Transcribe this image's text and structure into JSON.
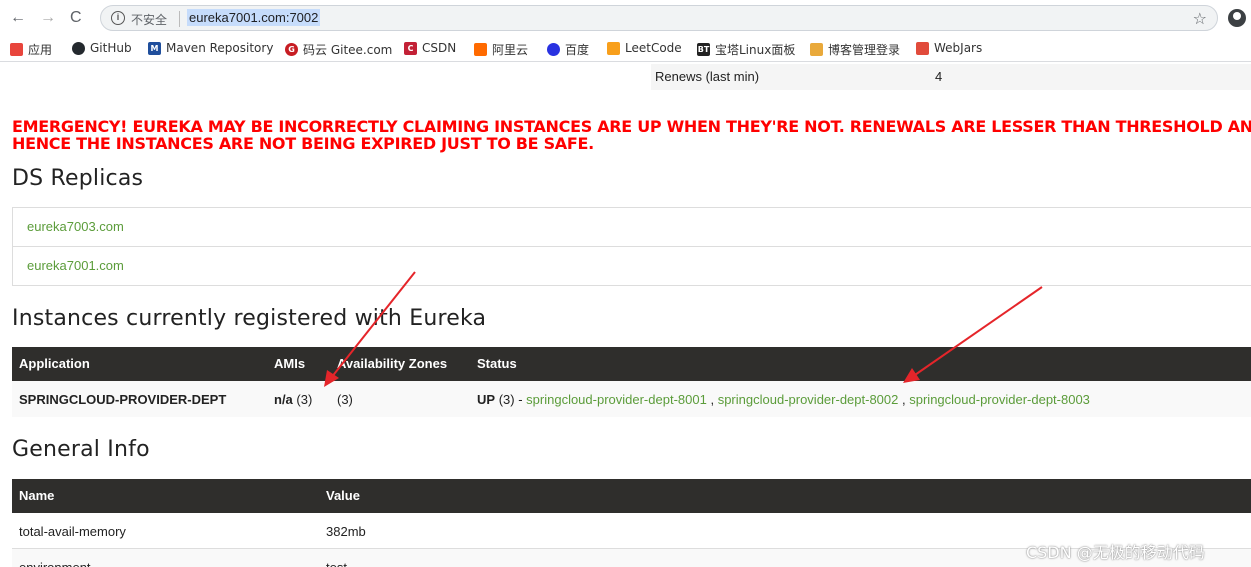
{
  "browser": {
    "insecure_label": "不安全",
    "url": "eureka7001.com:7002",
    "bookmarks": [
      {
        "label": "应用",
        "color": "#e8453c"
      },
      {
        "label": "GitHub",
        "color": "#24292e"
      },
      {
        "label": "Maven Repository",
        "color": "#1f4e9c"
      },
      {
        "label": "码云 Gitee.com",
        "color": "#c71d23"
      },
      {
        "label": "CSDN",
        "color": "#c32136"
      },
      {
        "label": "阿里云",
        "color": "#ff6a00"
      },
      {
        "label": "百度",
        "color": "#2932e1"
      },
      {
        "label": "LeetCode",
        "color": "#f89f1b"
      },
      {
        "label": "宝塔Linux面板",
        "color": "#222222"
      },
      {
        "label": "博客管理登录",
        "color": "#e9a93b"
      },
      {
        "label": "WebJars",
        "color": "#e14b3b"
      }
    ]
  },
  "renews": {
    "label": "Renews (last min)",
    "value": "4"
  },
  "emergency": {
    "line1": "EMERGENCY! EUREKA MAY BE INCORRECTLY CLAIMING INSTANCES ARE UP WHEN THEY'RE NOT. RENEWALS ARE LESSER THAN THRESHOLD AND",
    "line2": "HENCE THE INSTANCES ARE NOT BEING EXPIRED JUST TO BE SAFE."
  },
  "replicas": {
    "title": "DS Replicas",
    "items": [
      "eureka7003.com",
      "eureka7001.com"
    ]
  },
  "instances": {
    "title": "Instances currently registered with Eureka",
    "headers": [
      "Application",
      "AMIs",
      "Availability Zones",
      "Status"
    ],
    "row": {
      "application": "SPRINGCLOUD-PROVIDER-DEPT",
      "amis_bold": "n/a",
      "amis_count": "(3)",
      "zones": "(3)",
      "status_bold": "UP",
      "status_count": "(3) -",
      "links": [
        "springcloud-provider-dept-8001",
        "springcloud-provider-dept-8002",
        "springcloud-provider-dept-8003"
      ],
      "link_sep": ","
    }
  },
  "general": {
    "title": "General Info",
    "headers": [
      "Name",
      "Value"
    ],
    "rows": [
      {
        "name": "total-avail-memory",
        "value": "382mb"
      },
      {
        "name": "environment",
        "value": "test"
      }
    ]
  },
  "watermark": "CSDN @无极的移动代码"
}
